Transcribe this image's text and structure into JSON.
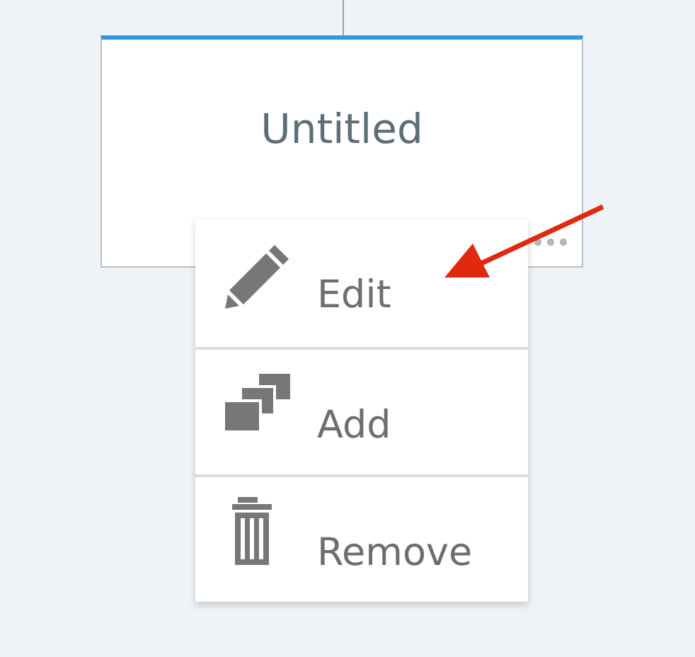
{
  "node": {
    "title": "Untitled"
  },
  "menu": {
    "items": [
      {
        "kind": "pencil",
        "label": "Edit"
      },
      {
        "kind": "stack",
        "label": "Add"
      },
      {
        "kind": "trash",
        "label": "Remove"
      }
    ]
  }
}
